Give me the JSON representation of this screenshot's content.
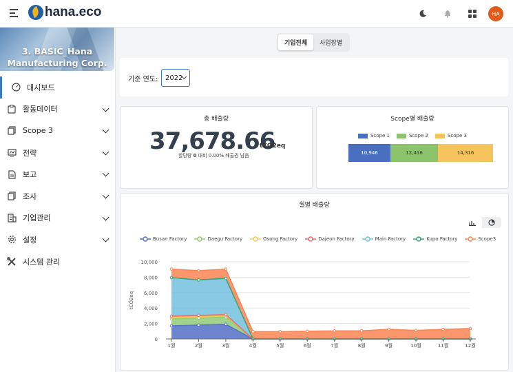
{
  "header": {
    "logo_text": "hana.eco",
    "avatar_initials": "HA"
  },
  "sidebar": {
    "banner_line1": "3. BASIC_Hana",
    "banner_line2": "Manufacturing Corp.",
    "items": [
      {
        "label": "대시보드",
        "icon": "gauge-icon"
      },
      {
        "label": "활동데이터",
        "icon": "clipboard-icon"
      },
      {
        "label": "Scope 3",
        "icon": "copy-icon"
      },
      {
        "label": "전략",
        "icon": "chart-icon"
      },
      {
        "label": "보고",
        "icon": "document-icon"
      },
      {
        "label": "조사",
        "icon": "copy-icon"
      },
      {
        "label": "기업관리",
        "icon": "building-icon"
      },
      {
        "label": "설정",
        "icon": "gear-icon"
      },
      {
        "label": "시스템 관리",
        "icon": "tools-icon"
      }
    ]
  },
  "tabs": [
    "기업전체",
    "사업장별"
  ],
  "filter": {
    "label": "기준 연도:",
    "year": "2022"
  },
  "total": {
    "title": "총 배출량",
    "value": "37,678.66",
    "unit": "tCO2eq",
    "sub_prefix": "할당량",
    "sub_bold": "0",
    "sub_suffix": "대비 0.00% 배출권 남음"
  },
  "scope_card": {
    "title": "Scope별 배출량"
  },
  "scope_chart": {
    "type": "bar",
    "stacked": true,
    "series": [
      {
        "name": "Scope 1",
        "value": 10946,
        "label": "10,946",
        "color": "#4a6fc0"
      },
      {
        "name": "Scope 2",
        "value": 12416,
        "label": "12,416",
        "color": "#8cc46e"
      },
      {
        "name": "Scope 3",
        "value": 14316,
        "label": "14,316",
        "color": "#f5c45c"
      }
    ]
  },
  "monthly_card": {
    "title": "월별 배출량"
  },
  "chart_data": {
    "type": "area",
    "stacked": true,
    "x": [
      "1월",
      "2월",
      "3월",
      "4월",
      "5월",
      "6월",
      "7월",
      "8월",
      "9월",
      "10월",
      "11월",
      "12월"
    ],
    "ylabel": "tCO2eq",
    "ylim": [
      0,
      10000
    ],
    "yticks": [
      "0",
      "2,000",
      "4,000",
      "6,000",
      "8,000",
      "10,000"
    ],
    "series": [
      {
        "name": "Busan Factory",
        "color": "#5470c6",
        "values": [
          1700,
          1800,
          1900,
          0,
          0,
          0,
          0,
          0,
          0,
          0,
          0,
          0
        ]
      },
      {
        "name": "Daegu Factory",
        "color": "#91cc75",
        "values": [
          900,
          900,
          950,
          0,
          0,
          0,
          0,
          0,
          0,
          0,
          0,
          0
        ]
      },
      {
        "name": "Osong Factory",
        "color": "#fac858",
        "values": [
          200,
          200,
          200,
          0,
          0,
          0,
          0,
          0,
          0,
          0,
          0,
          0
        ]
      },
      {
        "name": "Dajeon Factory",
        "color": "#ee6666",
        "values": [
          150,
          150,
          100,
          0,
          0,
          0,
          0,
          0,
          0,
          0,
          0,
          0
        ]
      },
      {
        "name": "Main Factory",
        "color": "#73c0de",
        "values": [
          5000,
          4600,
          4700,
          0,
          0,
          0,
          0,
          0,
          0,
          0,
          0,
          0
        ]
      },
      {
        "name": "Kupo Factory",
        "color": "#3ba272",
        "values": [
          0,
          0,
          0,
          0,
          0,
          0,
          0,
          0,
          0,
          0,
          0,
          0
        ]
      },
      {
        "name": "Scope3",
        "color": "#fc8452",
        "values": [
          1100,
          1200,
          1200,
          950,
          950,
          1000,
          1050,
          1050,
          1250,
          1100,
          1250,
          1350
        ]
      }
    ]
  }
}
